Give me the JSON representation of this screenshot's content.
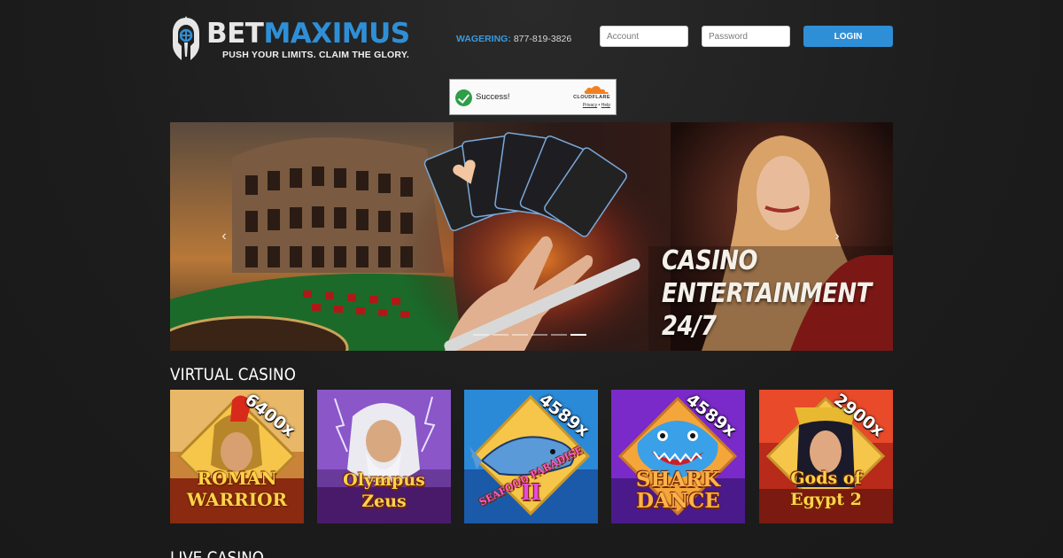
{
  "brand": {
    "name_part1": "BET",
    "name_part2": "MAXIMUS",
    "tagline": "PUSH YOUR LIMITS.  CLAIM THE GLORY."
  },
  "header": {
    "wagering_label": "WAGERING:",
    "wagering_phone": "877-819-3826",
    "account_placeholder": "Account",
    "password_placeholder": "Password",
    "login_label": "LOGIN"
  },
  "captcha": {
    "status": "Success!",
    "brand": "CLOUDFLARE",
    "privacy": "Privacy",
    "separator": "•",
    "help": "Help"
  },
  "hero": {
    "headline_line1": "CASINO",
    "headline_line2": "ENTERTAINMENT",
    "headline_line3": "24/7",
    "prev_arrow": "‹",
    "next_arrow": "›",
    "slide_count": 6,
    "active_slide": 6
  },
  "sections": {
    "virtual_casino": "VIRTUAL CASINO",
    "live_casino": "LIVE CASINO"
  },
  "games": [
    {
      "title_line1": "ROMAN",
      "title_line2": "WARRIOR",
      "multiplier": "6400x"
    },
    {
      "title_line1": "Olympus",
      "title_line2": "Zeus",
      "multiplier": ""
    },
    {
      "title_line1": "SEAFOOD PARADISE",
      "title_line2": "II",
      "multiplier": "4589x"
    },
    {
      "title_line1": "SHARK",
      "title_line2": "DANCE",
      "multiplier": "4589x"
    },
    {
      "title_line1": "Gods of",
      "title_line2": "Egypt 2",
      "multiplier": "2900x"
    }
  ],
  "colors": {
    "accent": "#2f8fd6",
    "background": "#1f1f1f",
    "captcha_success": "#2e9e48"
  }
}
